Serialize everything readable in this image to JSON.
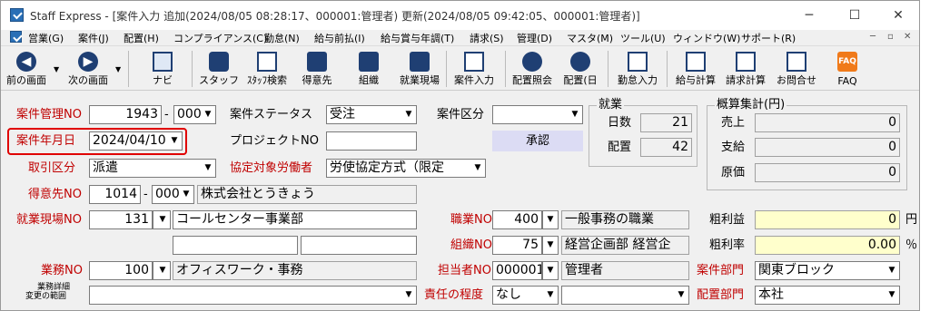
{
  "window": {
    "title": "Staff Express - [案件入力  追加(2024/08/05 08:28:17、000001:管理者)  更新(2024/08/05 09:42:05、000001:管理者)]",
    "min": "─",
    "max": "☐",
    "close": "✕"
  },
  "menu": [
    "営業(G)",
    "案件(J)",
    "配置(H)",
    "コンプライアンス(C)",
    "勤怠(N)",
    "給与前払(I)",
    "給与賞与年調(T)",
    "請求(S)",
    "管理(D)",
    "マスタ(M)",
    "ツール(U)",
    "ウィンドウ(W)",
    "サポート(R)"
  ],
  "mdi": {
    "min": "─",
    "restore": "▫",
    "close": "✕"
  },
  "toolbar": {
    "prev": "前の画面",
    "next": "次の画面",
    "nav": "ナビ",
    "staff": "スタッフ",
    "staff_search": "ｽﾀｯﾌ検索",
    "customer": "得意先",
    "org": "組織",
    "site": "就業現場",
    "case_input": "案件入力",
    "assign_inquiry": "配置照会",
    "assign_day": "配置(日",
    "attend_input": "勤怠入力",
    "payroll_calc": "給与計算",
    "billing_calc": "請求計算",
    "inquiry": "お問合せ",
    "faq": "FAQ",
    "faq_icon": "FAQ"
  },
  "form": {
    "case_no_label": "案件管理NO",
    "case_no": "1943",
    "case_no_dash": "-",
    "case_no_sub": "000",
    "status_label": "案件ステータス",
    "status": "受注",
    "division_label": "案件区分",
    "division": "",
    "date_label": "案件年月日",
    "date": "2024/04/10",
    "project_label": "プロジェクトNO",
    "project": "",
    "approve": "承認",
    "trade_label": "取引区分",
    "trade": "派遣",
    "agreement_label": "協定対象労働者",
    "agreement": "労使協定方式（限定",
    "customer_label": "得意先NO",
    "customer_no": "1014",
    "customer_dash": "-",
    "customer_sub": "000",
    "customer_name": "株式会社とうきょう",
    "site_label": "就業現場NO",
    "site_no": "131",
    "site_name": "コールセンター事業部",
    "job_label": "職業NO",
    "job_no": "400",
    "job_name": "一般事務の職業",
    "org_label": "組織NO",
    "org_no": "75",
    "org_name": "経営企画部 経営企",
    "work_label": "業務NO",
    "work_no": "100",
    "work_name": "オフィスワーク・事務",
    "staff_label": "担当者NO",
    "staff_no": "000001",
    "staff_name": "管理者",
    "dept_label": "案件部門",
    "dept": "関東ブロック",
    "detail_label_1": "業務詳細",
    "detail_label_2": "変更の範囲",
    "detail": "",
    "resp_label": "責任の程度",
    "resp": "なし",
    "resp2": "",
    "assign_dept_label": "配置部門",
    "assign_dept": "本社",
    "gross_label": "粗利益",
    "gross": "0",
    "gross_unit": "円",
    "rate_label": "粗利率",
    "rate": "0.00",
    "rate_unit": "％"
  },
  "work_summary": {
    "title": "就業",
    "days_label": "日数",
    "days": "21",
    "assign_label": "配置",
    "assign": "42"
  },
  "totals": {
    "title": "概算集計(円)",
    "sales_label": "売上",
    "sales": "0",
    "pay_label": "支給",
    "pay": "0",
    "cost_label": "原価",
    "cost": "0"
  },
  "colors": {
    "required_label": "#c00000",
    "highlight": "#e00000",
    "approve_bg": "#dcdcf4",
    "yellow_field": "#ffffcc"
  }
}
